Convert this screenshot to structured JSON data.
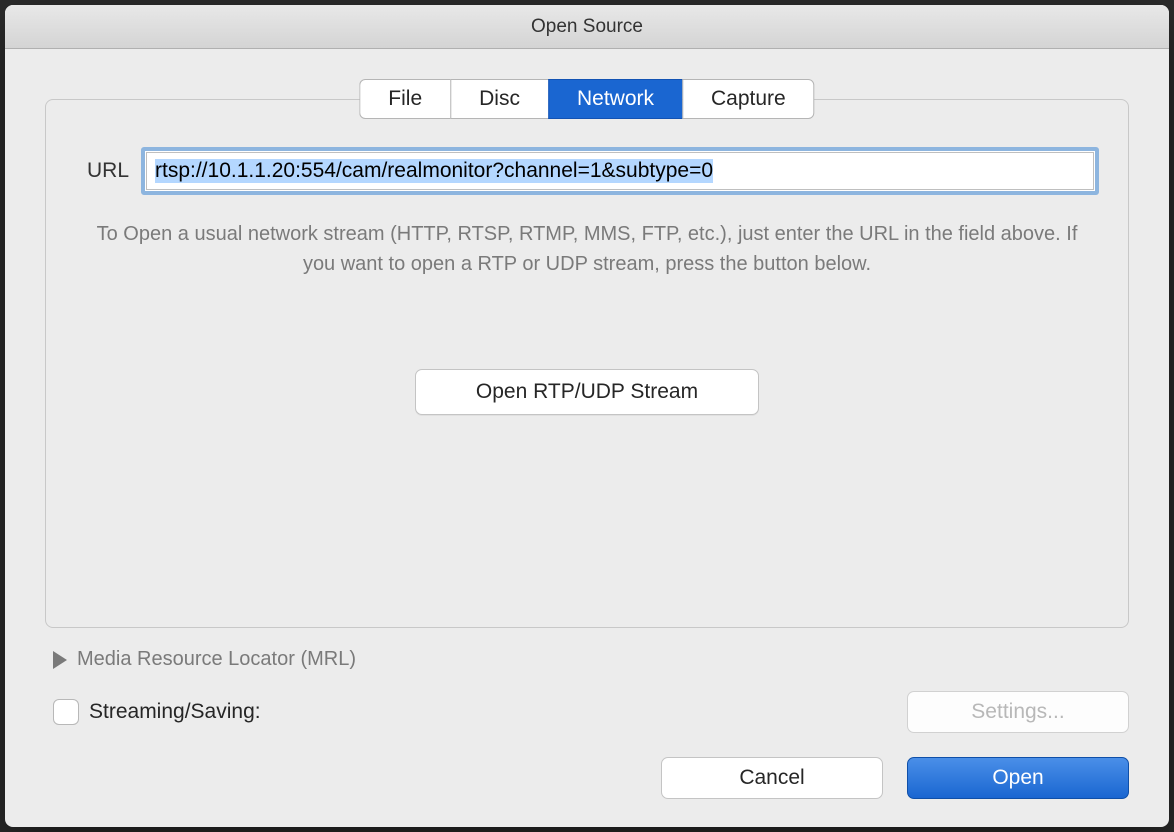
{
  "window": {
    "title": "Open Source"
  },
  "tabs": {
    "file": "File",
    "disc": "Disc",
    "network": "Network",
    "capture": "Capture",
    "active": "network"
  },
  "network": {
    "url_label": "URL",
    "url_value": "rtsp://10.1.1.20:554/cam/realmonitor?channel=1&subtype=0",
    "help_text": "To Open a usual network stream (HTTP, RTSP, RTMP, MMS, FTP, etc.), just enter the URL in the field above. If you want to open a RTP or UDP stream, press the button below.",
    "rtp_button_label": "Open RTP/UDP Stream"
  },
  "mrl": {
    "label": "Media Resource Locator (MRL)",
    "expanded": false
  },
  "streaming": {
    "checkbox_label": "Streaming/Saving:",
    "checked": false,
    "settings_button_label": "Settings...",
    "settings_enabled": false
  },
  "buttons": {
    "cancel": "Cancel",
    "open": "Open"
  }
}
